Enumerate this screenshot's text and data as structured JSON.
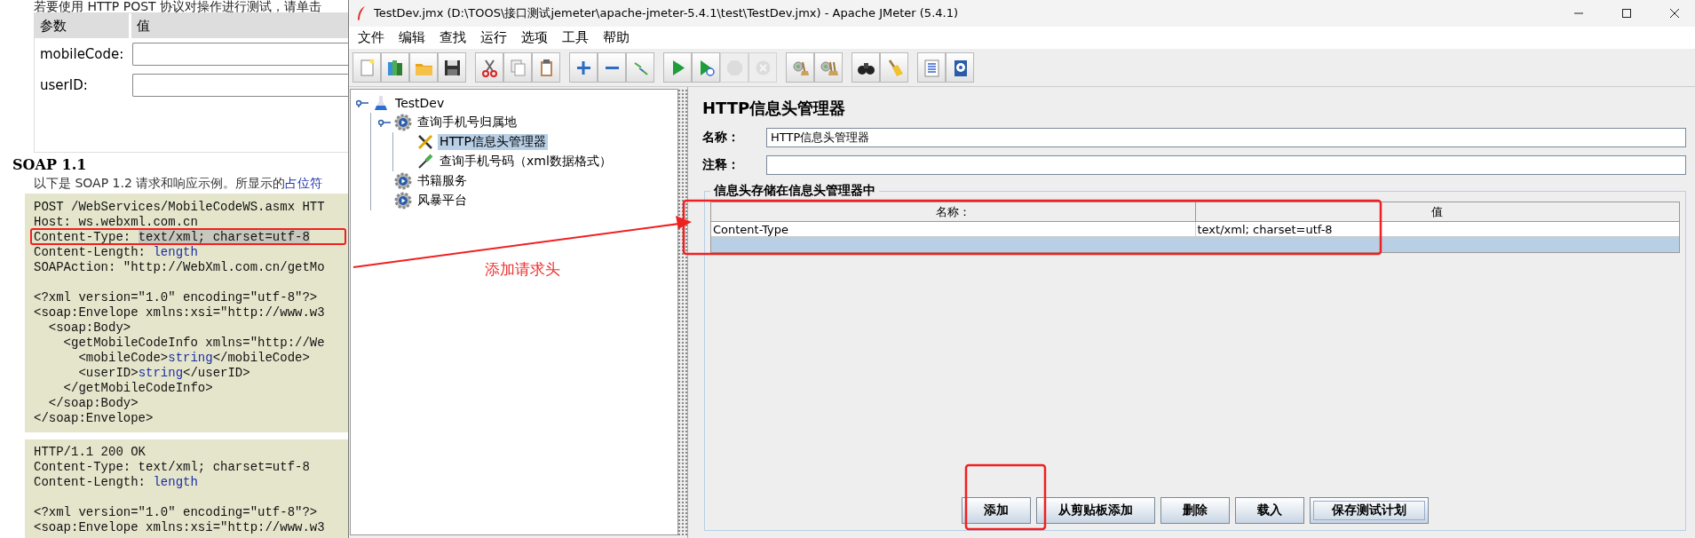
{
  "background_page": {
    "intro": "若要使用 HTTP POST 协议对操作进行测试，请单击",
    "params_table": {
      "columns": [
        "参数",
        "值"
      ],
      "rows": [
        {
          "label": "mobileCode:"
        },
        {
          "label": "userID:"
        }
      ]
    },
    "heading": "SOAP 1.1",
    "description": {
      "text": "以下是 SOAP 1.2 请求和响应示例。所显示的",
      "link": "占位符"
    },
    "code_blocks": [
      {
        "lines": [
          {
            "kind": "code",
            "segments": [
              {
                "kind": "text",
                "text": "POST /WebServices/MobileCodeWS.asmx HTT"
              }
            ]
          },
          {
            "kind": "code",
            "segments": [
              {
                "kind": "text",
                "text": "Host: ws.webxml.com.cn"
              }
            ]
          },
          {
            "kind": "code",
            "segments": [
              {
                "kind": "text",
                "text": "Content-Type: "
              },
              {
                "kind": "selection",
                "text": "text/xml; charset=utf-8"
              }
            ]
          },
          {
            "kind": "code",
            "segments": [
              {
                "kind": "text",
                "text": "Content-Length: "
              },
              {
                "kind": "placeholder",
                "text": "length"
              }
            ]
          },
          {
            "kind": "code",
            "segments": [
              {
                "kind": "text",
                "text": "SOAPAction: \"http://WebXml.com.cn/getMo"
              }
            ]
          },
          {
            "kind": "blank"
          },
          {
            "kind": "code",
            "segments": [
              {
                "kind": "text",
                "text": "<?xml version=\"1.0\" encoding=\"utf-8\"?>"
              }
            ]
          },
          {
            "kind": "code",
            "segments": [
              {
                "kind": "text",
                "text": "<soap:Envelope xmlns:xsi=\"http://www.w3"
              }
            ]
          },
          {
            "kind": "code",
            "segments": [
              {
                "kind": "text",
                "text": "  <soap:Body>"
              }
            ]
          },
          {
            "kind": "code",
            "segments": [
              {
                "kind": "text",
                "text": "    <getMobileCodeInfo xmlns=\"http://We"
              }
            ]
          },
          {
            "kind": "code",
            "segments": [
              {
                "kind": "text",
                "text": "      <mobileCode>"
              },
              {
                "kind": "placeholder",
                "text": "string"
              },
              {
                "kind": "text",
                "text": "</mobileCode>"
              }
            ]
          },
          {
            "kind": "code",
            "segments": [
              {
                "kind": "text",
                "text": "      <userID>"
              },
              {
                "kind": "placeholder",
                "text": "string"
              },
              {
                "kind": "text",
                "text": "</userID>"
              }
            ]
          },
          {
            "kind": "code",
            "segments": [
              {
                "kind": "text",
                "text": "    </getMobileCodeInfo>"
              }
            ]
          },
          {
            "kind": "code",
            "segments": [
              {
                "kind": "text",
                "text": "  </soap:Body>"
              }
            ]
          },
          {
            "kind": "code",
            "segments": [
              {
                "kind": "text",
                "text": "</soap:Envelope>"
              }
            ]
          }
        ]
      },
      {
        "lines": [
          {
            "kind": "code",
            "segments": [
              {
                "kind": "text",
                "text": "HTTP/1.1 200 OK"
              }
            ]
          },
          {
            "kind": "code",
            "segments": [
              {
                "kind": "text",
                "text": "Content-Type: text/xml; charset=utf-8"
              }
            ]
          },
          {
            "kind": "code",
            "segments": [
              {
                "kind": "text",
                "text": "Content-Length: "
              },
              {
                "kind": "placeholder",
                "text": "length"
              }
            ]
          },
          {
            "kind": "blank"
          },
          {
            "kind": "code",
            "segments": [
              {
                "kind": "text",
                "text": "<?xml version=\"1.0\" encoding=\"utf-8\"?>"
              }
            ]
          },
          {
            "kind": "code",
            "segments": [
              {
                "kind": "text",
                "text": "<soap:Envelope xmlns:xsi=\"http://www.w3"
              }
            ]
          }
        ]
      }
    ]
  },
  "window": {
    "title": "TestDev.jmx (D:\\TOOS\\接口测试jemeter\\apache-jmeter-5.4.1\\test\\TestDev.jmx) - Apache JMeter (5.4.1)"
  },
  "menu": [
    "文件",
    "编辑",
    "查找",
    "运行",
    "选项",
    "工具",
    "帮助"
  ],
  "toolbar": [
    {
      "items": [
        {
          "disabled": false
        },
        {
          "disabled": false
        },
        {
          "disabled": false
        },
        {
          "disabled": false
        }
      ]
    },
    {
      "items": [
        {
          "disabled": false
        },
        {
          "disabled": false
        },
        {
          "disabled": false
        }
      ]
    },
    {
      "items": [
        {
          "disabled": false
        },
        {
          "disabled": false
        },
        {
          "disabled": false
        }
      ]
    },
    {
      "items": [
        {
          "disabled": false
        },
        {
          "disabled": false
        },
        {
          "disabled": true
        },
        {
          "disabled": true
        }
      ]
    },
    {
      "items": [
        {
          "disabled": false
        },
        {
          "disabled": false
        }
      ]
    },
    {
      "items": [
        {
          "disabled": false
        },
        {
          "disabled": false
        }
      ]
    },
    {
      "items": [
        {
          "disabled": false
        },
        {
          "disabled": false
        }
      ]
    }
  ],
  "tree": [
    {
      "label": "TestDev",
      "kind": "test-plan",
      "selected": false,
      "expanded": true,
      "children": [
        {
          "label": "查询手机号归属地",
          "kind": "thread-group",
          "selected": false,
          "expanded": true,
          "children": [
            {
              "label": "HTTP信息头管理器",
              "kind": "config",
              "selected": true,
              "expanded": false
            },
            {
              "label": "查询手机号码（xml数据格式）",
              "kind": "sampler",
              "selected": false,
              "expanded": false
            }
          ]
        },
        {
          "label": "书籍服务",
          "kind": "thread-group",
          "selected": false,
          "expanded": false
        },
        {
          "label": "风暴平台",
          "kind": "thread-group",
          "selected": false,
          "expanded": false
        }
      ]
    }
  ],
  "editor": {
    "title": "HTTP信息头管理器",
    "name_field": {
      "label": "名称：",
      "value": "HTTP信息头管理器"
    },
    "comment_field": {
      "label": "注释："
    },
    "headers": {
      "legend": "信息头存储在信息头管理器中",
      "columns": [
        "名称：",
        "值"
      ],
      "rows": [
        {
          "cells": [
            "Content-Type",
            "text/xml; charset=utf-8"
          ],
          "selected": false
        },
        {
          "selected": true
        }
      ]
    },
    "buttons": [
      {
        "label": "添加",
        "focused": false
      },
      {
        "label": "从剪贴板添加",
        "focused": false
      },
      {
        "label": "删除",
        "focused": false
      },
      {
        "label": "载入",
        "focused": false
      },
      {
        "label": "保存测试计划",
        "focused": true
      }
    ]
  },
  "annotations": {
    "callout": "添加请求头"
  }
}
